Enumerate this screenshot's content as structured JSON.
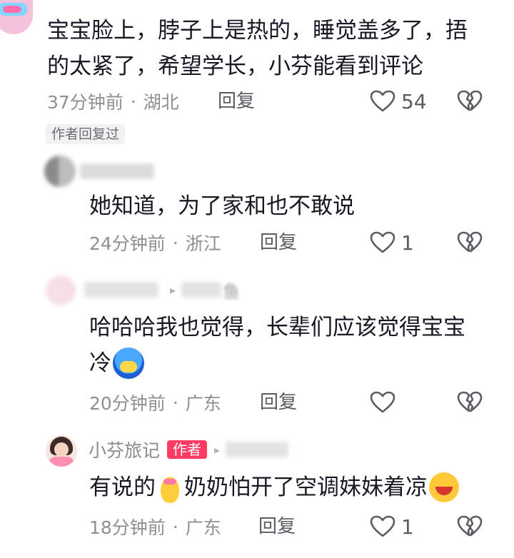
{
  "comments": [
    {
      "id": "c1",
      "text_line_1": "宝宝脸上，脖子上是热的，睡觉盖多了，捂",
      "text_line_2": "的太紧了，希望学长，小芬能看到评论",
      "time": "37分钟前",
      "location": "湖北",
      "reply_label": "回复",
      "likes": "54",
      "author_replied_tag": "作者回复过"
    },
    {
      "id": "c2",
      "text": "她知道，为了家和也不敢说",
      "time": "24分钟前",
      "location": "浙江",
      "reply_label": "回复",
      "likes": "1"
    },
    {
      "id": "c3",
      "reply_to_suffix": "鱼",
      "text_line_1": "哈哈哈我也觉得，长辈们应该觉得宝宝",
      "text_line_2": "冷",
      "time": "20分钟前",
      "location": "广东",
      "reply_label": "回复",
      "likes": ""
    },
    {
      "id": "c4",
      "name": "小芬旅记",
      "badge": "作者",
      "text_part_1": "有说的",
      "text_part_2": "奶奶怕开了空调妹妹着凉",
      "time": "18分钟前",
      "location": "广东",
      "reply_label": "回复",
      "likes": "1"
    }
  ],
  "separator": "·",
  "icons": {
    "like": "heart-outline-icon",
    "dislike": "broken-heart-icon",
    "reply_arrow": "reply-arrow-icon"
  },
  "colors": {
    "text": "#161823",
    "meta": "#8e8e94",
    "author_badge": "#ff3b63",
    "tag_bg": "#f1f1f3"
  }
}
